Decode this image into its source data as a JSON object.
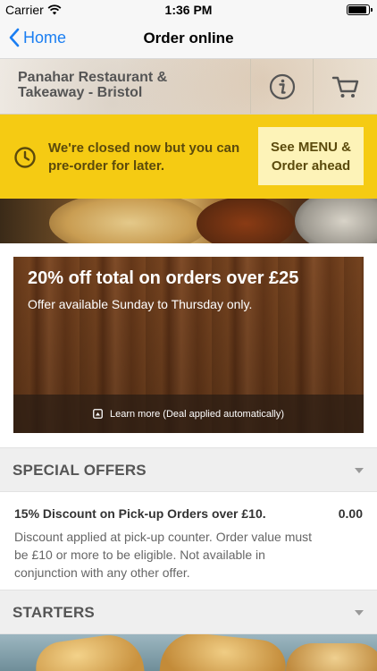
{
  "status_bar": {
    "carrier": "Carrier",
    "time": "1:36 PM"
  },
  "nav": {
    "back_label": "Home",
    "title": "Order online"
  },
  "restaurant": {
    "name": "Panahar Restaurant & Takeaway - Bristol"
  },
  "closed_banner": {
    "message": "We're closed now but you can pre-order for later.",
    "button_label": "See MENU & Order ahead",
    "background": "#f5cb13"
  },
  "deal": {
    "title": "20% off total on orders over £25",
    "subtitle": "Offer available Sunday to Thursday only.",
    "footer": "Learn more (Deal applied automatically)"
  },
  "sections": [
    {
      "label": "SPECIAL OFFERS"
    },
    {
      "label": "STARTERS"
    }
  ],
  "offer_item": {
    "title": "15% Discount on Pick-up Orders over £10.",
    "price": "0.00",
    "description": "Discount applied at pick-up counter. Order value must be £10 or more to be eligible. Not available in conjunction with any other offer."
  },
  "icons": [
    "back-chevron-icon",
    "wifi-icon",
    "battery-icon",
    "info-icon",
    "cart-icon",
    "clock-icon",
    "info-square-icon",
    "chevron-down-icon"
  ],
  "colors": {
    "accent": "#1a7ef2",
    "banner": "#f5cb13"
  }
}
